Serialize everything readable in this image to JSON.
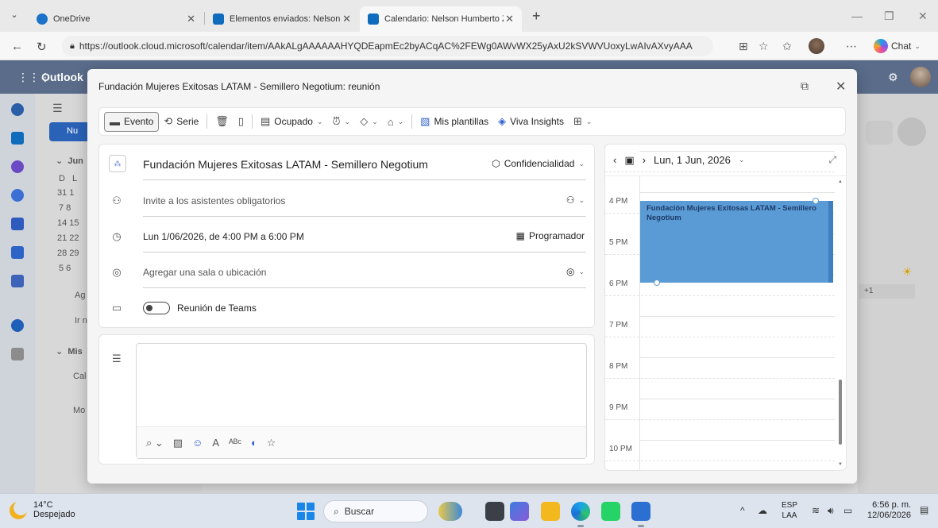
{
  "browser": {
    "tabs": [
      {
        "label": "OneDrive"
      },
      {
        "label": "Elementos enviados: Nelson Humb"
      },
      {
        "label": "Calendario: Nelson Humberto Zam"
      }
    ],
    "url": "https://outlook.cloud.microsoft/calendar/item/AAkALgAAAAAAHYQDEapmEc2byACqAC%2FEWg0AWvWX25yAxU2kSVWVUoxyLwAIvAXvyAAA",
    "chat_label": "Chat"
  },
  "outlook": {
    "app_name": "Outlook",
    "new_button": "Nu",
    "mini_month": "Jun",
    "mini_days": [
      "D",
      "L"
    ],
    "mini_rows": [
      "31  1",
      "7  8",
      "14  15",
      "21  22",
      "28  29",
      "5  6"
    ],
    "side_items": [
      "Ag",
      "Ir n",
      "Mis",
      "Cal",
      "Mo"
    ],
    "plus_more": "+1"
  },
  "modal": {
    "title": "Fundación Mujeres Exitosas LATAM - Semillero Negotium: reunión",
    "toolbar": {
      "evento": "Evento",
      "serie": "Serie",
      "ocupado": "Ocupado",
      "mis_plantillas": "Mis plantillas",
      "viva_insights": "Viva Insights"
    },
    "form": {
      "event_title": "Fundación Mujeres Exitosas LATAM - Semillero Negotium",
      "confidencialidad": "Confidencialidad",
      "attendees_placeholder": "Invite a los asistentes obligatorios",
      "datetime": "Lun 1/06/2026, de 4:00 PM a 6:00 PM",
      "programador": "Programador",
      "location_placeholder": "Agregar una sala o ubicación",
      "teams_label": "Reunión de Teams"
    },
    "calendar": {
      "date": "Lun, 1 Jun, 2026",
      "hours": [
        "4 PM",
        "5 PM",
        "6 PM",
        "7 PM",
        "8 PM",
        "9 PM",
        "10 PM"
      ],
      "event_text": "Fundación Mujeres Exitosas LATAM - Semillero Negotium"
    }
  },
  "taskbar": {
    "temp": "14°C",
    "weather": "Despejado",
    "search_label": "Buscar",
    "lang1": "ESP",
    "lang2": "LAA",
    "time": "6:56 p. m.",
    "date": "12/06/2026"
  }
}
